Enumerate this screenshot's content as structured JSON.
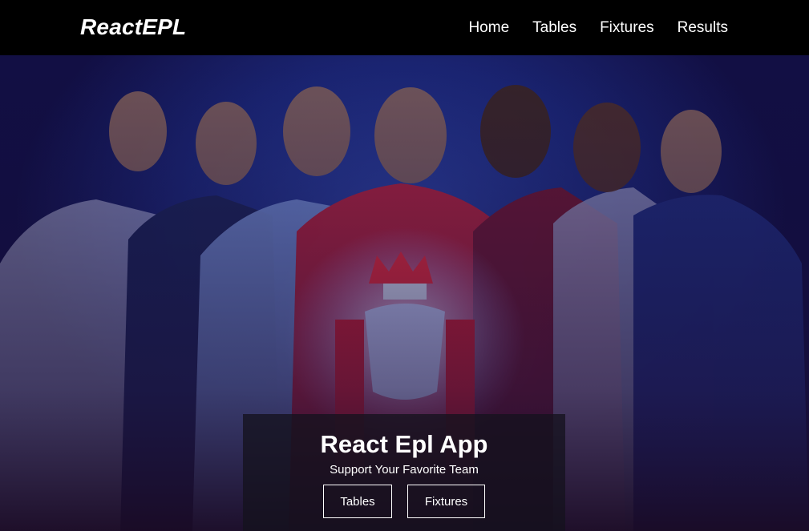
{
  "navbar": {
    "brand": "ReactEPL",
    "links": [
      "Home",
      "Tables",
      "Fixtures",
      "Results"
    ]
  },
  "hero": {
    "title": "React Epl App",
    "subtitle": "Support Your Favorite Team",
    "buttons": [
      "Tables",
      "Fixtures"
    ],
    "image_description_icon": "players-with-trophy-image"
  },
  "colors": {
    "navbar_bg": "#000000",
    "hero_bg": "#1a2472",
    "caption_bg": "#14121e",
    "text": "#ffffff"
  }
}
